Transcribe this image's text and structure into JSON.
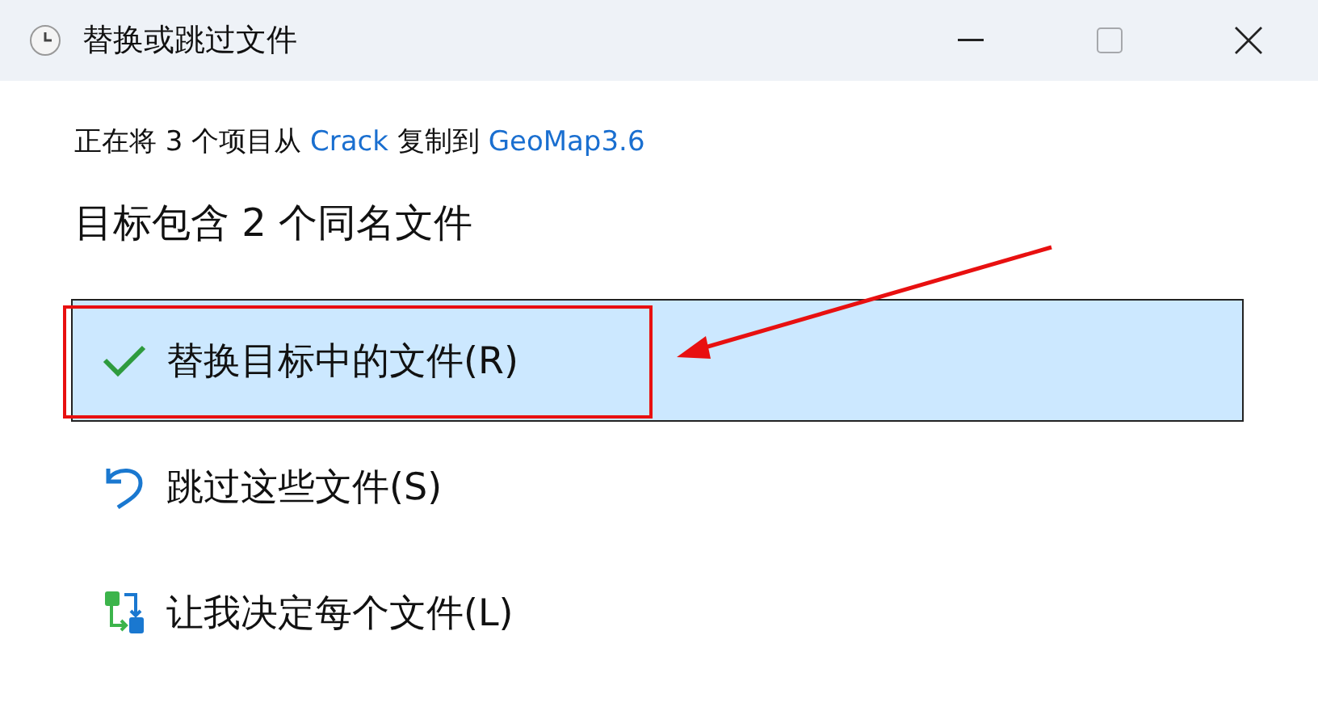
{
  "window": {
    "title": "替换或跳过文件",
    "maximize_disabled": true
  },
  "copy_info": {
    "prefix": "正在将 3 个项目从",
    "source": "Crack",
    "middle": "复制到",
    "destination": "GeoMap3.6"
  },
  "heading": "目标包含 2 个同名文件",
  "options": [
    {
      "kind": "replace",
      "label": "替换目标中的文件(R)",
      "selected": true,
      "annotated": true
    },
    {
      "kind": "skip",
      "label": "跳过这些文件(S)",
      "selected": false,
      "annotated": false
    },
    {
      "kind": "decide",
      "label": "让我决定每个文件(L)",
      "selected": false,
      "annotated": false
    }
  ]
}
